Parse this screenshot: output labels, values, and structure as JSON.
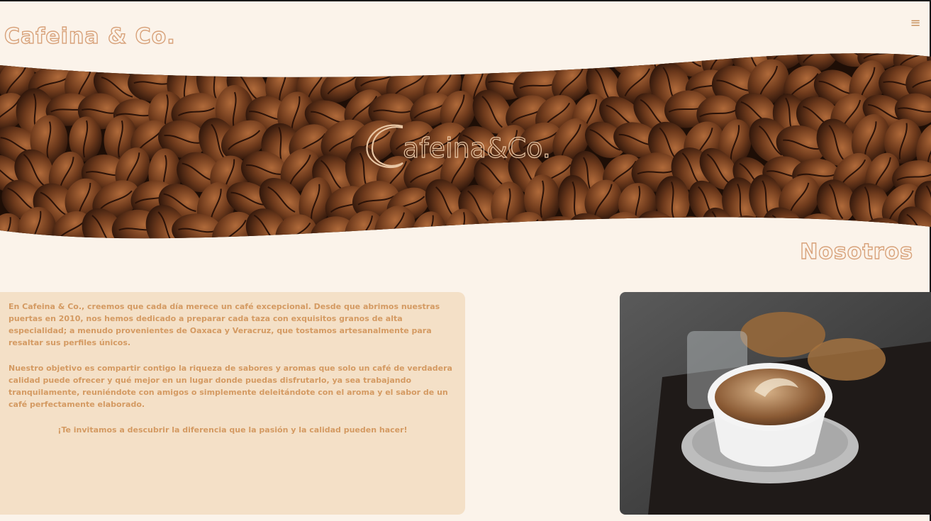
{
  "header": {
    "brand": "Cafeina & Co.",
    "menu_icon": "hamburger-menu-icon"
  },
  "hero": {
    "logo_text": "afeina&Co.",
    "image": "coffee-beans-banner"
  },
  "about": {
    "title": "Nosotros",
    "paragraph_1": "En Cafeina & Co., creemos que cada día merece un café excepcional. Desde que abrimos nuestras puertas en 2010, nos hemos dedicado a preparar cada taza con exquisitos granos de alta especialidad; a menudo provenientes de Oaxaca y Veracruz, que tostamos artesanalmente para resaltar sus perfiles únicos.",
    "paragraph_2": "Nuestro objetivo es compartir contigo la riqueza de sabores y aromas que solo un café de verdadera calidad puede ofrecer y qué mejor en un lugar donde puedas disfrutarlo, ya sea trabajando tranquilamente, reuniéndote con amigos o simplemente deleitándote con el aroma y el sabor de un café perfectamente elaborado.",
    "paragraph_3": "¡Te invitamos a descubrir la diferencia que la pasión y la calidad pueden hacer!",
    "photo": "latte-art-cup-photo"
  },
  "colors": {
    "background": "#fbf3ea",
    "accent": "#d8a27a",
    "card": "#f4e0c7",
    "text": "#d49a62"
  }
}
